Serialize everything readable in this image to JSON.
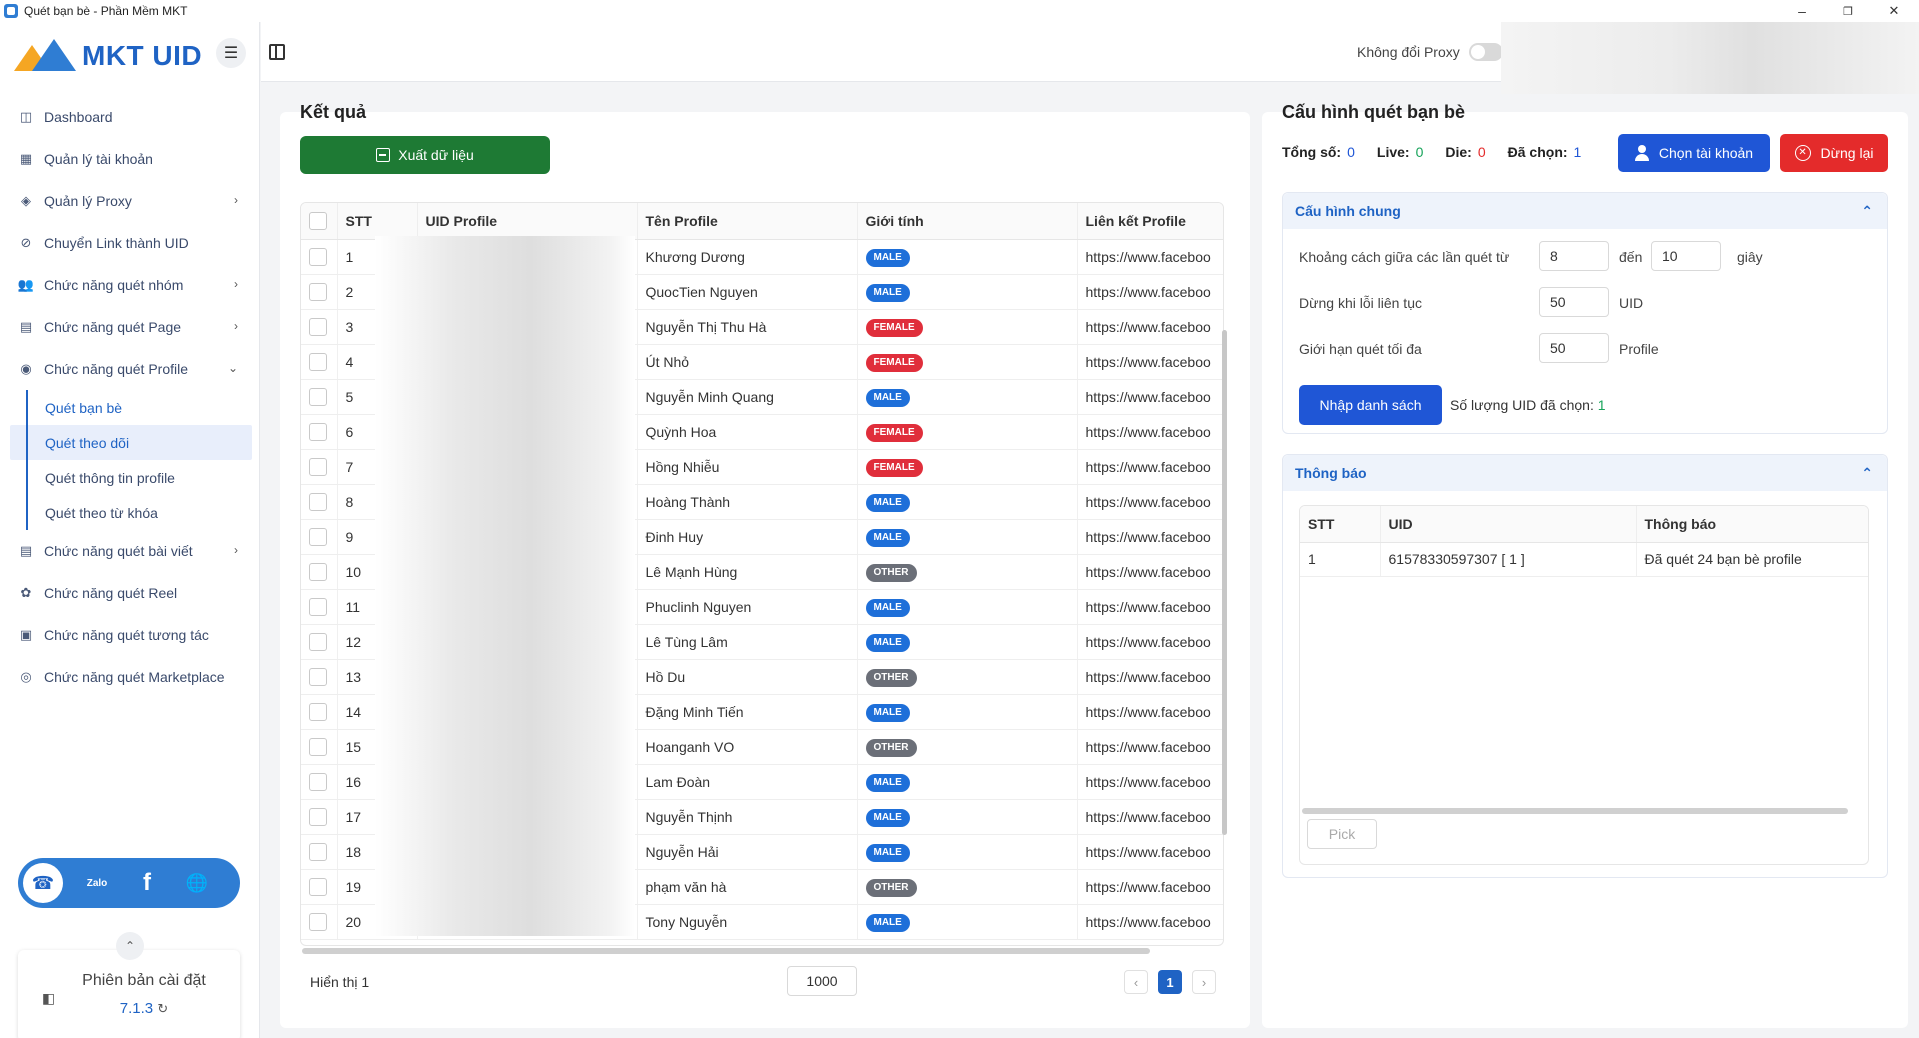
{
  "window": {
    "title": "Quét bạn bè - Phần Mềm MKT",
    "minimize": "–",
    "maximize": "❐",
    "close": "✕"
  },
  "sidebar": {
    "logo_text": "MKT UID",
    "menu_icon": "☰",
    "items": [
      {
        "label": "Dashboard",
        "icon": "layout-icon",
        "glyph": "◫"
      },
      {
        "label": "Quản lý tài khoản",
        "icon": "grid-icon",
        "glyph": "▦"
      },
      {
        "label": "Quản lý Proxy",
        "icon": "layers-icon",
        "glyph": "◈",
        "chev": "›"
      },
      {
        "label": "Chuyển Link thành UID",
        "icon": "link-icon",
        "glyph": "⊘"
      },
      {
        "label": "Chức năng quét nhóm",
        "icon": "group-icon",
        "glyph": "👥",
        "chev": "›"
      },
      {
        "label": "Chức năng quét Page",
        "icon": "page-icon",
        "glyph": "▤",
        "chev": "›"
      },
      {
        "label": "Chức năng quét Profile",
        "icon": "profile-icon",
        "glyph": "◉",
        "chev": "⌄"
      }
    ],
    "sub_items": [
      "Quét bạn bè",
      "Quét theo dõi",
      "Quét thông tin profile",
      "Quét theo từ khóa"
    ],
    "items_after": [
      {
        "label": "Chức năng quét bài viết",
        "icon": "post-icon",
        "glyph": "▤",
        "chev": "›"
      },
      {
        "label": "Chức năng quét Reel",
        "icon": "reel-icon",
        "glyph": "✿"
      },
      {
        "label": "Chức năng quét tương tác",
        "icon": "interaction-icon",
        "glyph": "▣"
      },
      {
        "label": "Chức năng quét Marketplace",
        "icon": "marketplace-icon",
        "glyph": "◎"
      }
    ],
    "social": {
      "support": "☎",
      "zalo": "Zalo",
      "facebook": "f",
      "web": "🌐"
    },
    "collapse": "⌃",
    "version_label": "Phiên bản cài đặt",
    "version": "7.1.3",
    "version_refresh": "↻",
    "version_icon": "◧"
  },
  "topbar": {
    "proxy_label": "Không đổi Proxy"
  },
  "results": {
    "title": "Kết quả",
    "export_label": "Xuất dữ liệu",
    "columns": [
      "STT",
      "UID Profile",
      "Tên Profile",
      "Giới tính",
      "Liên kết Profile"
    ],
    "rows": [
      {
        "stt": "1",
        "name": "Khương Dương",
        "gender": "MALE",
        "link": "https://www.faceboo"
      },
      {
        "stt": "2",
        "name": "QuocTien Nguyen",
        "gender": "MALE",
        "link": "https://www.faceboo"
      },
      {
        "stt": "3",
        "name": "Nguyễn Thị Thu Hà",
        "gender": "FEMALE",
        "link": "https://www.faceboo"
      },
      {
        "stt": "4",
        "name": "Út Nhỏ",
        "gender": "FEMALE",
        "link": "https://www.faceboo"
      },
      {
        "stt": "5",
        "name": "Nguyễn Minh Quang",
        "gender": "MALE",
        "link": "https://www.faceboo"
      },
      {
        "stt": "6",
        "name": "Quỳnh Hoa",
        "gender": "FEMALE",
        "link": "https://www.faceboo"
      },
      {
        "stt": "7",
        "name": "Hồng Nhiễu",
        "gender": "FEMALE",
        "link": "https://www.faceboo"
      },
      {
        "stt": "8",
        "name": "Hoàng Thành",
        "gender": "MALE",
        "link": "https://www.faceboo"
      },
      {
        "stt": "9",
        "name": "Đinh Huy",
        "gender": "MALE",
        "link": "https://www.faceboo"
      },
      {
        "stt": "10",
        "name": "Lê Mạnh Hùng",
        "gender": "OTHER",
        "link": "https://www.faceboo"
      },
      {
        "stt": "11",
        "name": "Phuclinh Nguyen",
        "gender": "MALE",
        "link": "https://www.faceboo"
      },
      {
        "stt": "12",
        "name": "Lê Tùng Lâm",
        "gender": "MALE",
        "link": "https://www.faceboo"
      },
      {
        "stt": "13",
        "name": "Hồ Du",
        "gender": "OTHER",
        "link": "https://www.faceboo"
      },
      {
        "stt": "14",
        "name": "Đặng Minh Tiến",
        "gender": "MALE",
        "link": "https://www.faceboo"
      },
      {
        "stt": "15",
        "name": "Hoanganh VO",
        "gender": "OTHER",
        "link": "https://www.faceboo"
      },
      {
        "stt": "16",
        "name": "Lam Đoàn",
        "gender": "MALE",
        "link": "https://www.faceboo"
      },
      {
        "stt": "17",
        "name": "Nguyễn Thịnh",
        "gender": "MALE",
        "link": "https://www.faceboo"
      },
      {
        "stt": "18",
        "name": "Nguyễn Hải",
        "gender": "MALE",
        "link": "https://www.faceboo"
      },
      {
        "stt": "19",
        "name": "phạm văn hà",
        "gender": "OTHER",
        "link": "https://www.faceboo"
      },
      {
        "stt": "20",
        "name": "Tony Nguyễn",
        "gender": "MALE",
        "link": "https://www.faceboo"
      }
    ],
    "footer_text": "Hiển thị 1",
    "page_size": "1000",
    "current_page": "1",
    "prev": "‹",
    "next": "›"
  },
  "config": {
    "title": "Cấu hình quét bạn bè",
    "stats": {
      "total_label": "Tổng số:",
      "total": "0",
      "live_label": "Live:",
      "live": "0",
      "die_label": "Die:",
      "die": "0",
      "selected_label": "Đã chọn:",
      "selected": "1"
    },
    "choose_account": "Chọn tài khoản",
    "stop": "Dừng lại",
    "general": {
      "title": "Cấu hình chung",
      "collapse": "⌃",
      "interval_label": "Khoảng cách giữa các lần quét từ",
      "interval_from": "8",
      "to_label": "đến",
      "interval_to": "10",
      "seconds": "giây",
      "stop_error_label": "Dừng khi lỗi liên tục",
      "stop_error_value": "50",
      "stop_error_unit": "UID",
      "max_label": "Giới hạn quét tối đa",
      "max_value": "50",
      "max_unit": "Profile",
      "import_label": "Nhập danh sách",
      "uid_count_label": "Số lượng UID đã chọn:",
      "uid_count": "1"
    },
    "notice": {
      "title": "Thông báo",
      "collapse": "⌃",
      "columns": [
        "STT",
        "UID",
        "Thông báo"
      ],
      "rows": [
        {
          "stt": "1",
          "uid": "61578330597307 [ 1 ]",
          "message": "Đã quét 24 bạn bè profile"
        }
      ],
      "pick_label": "Pick"
    }
  },
  "colors": {
    "primary": "#1f56d6",
    "export": "#1e7a34",
    "stop": "#e42b2b",
    "male": "#1e6fd9",
    "female": "#e02e3b",
    "other": "#6b6f78"
  }
}
